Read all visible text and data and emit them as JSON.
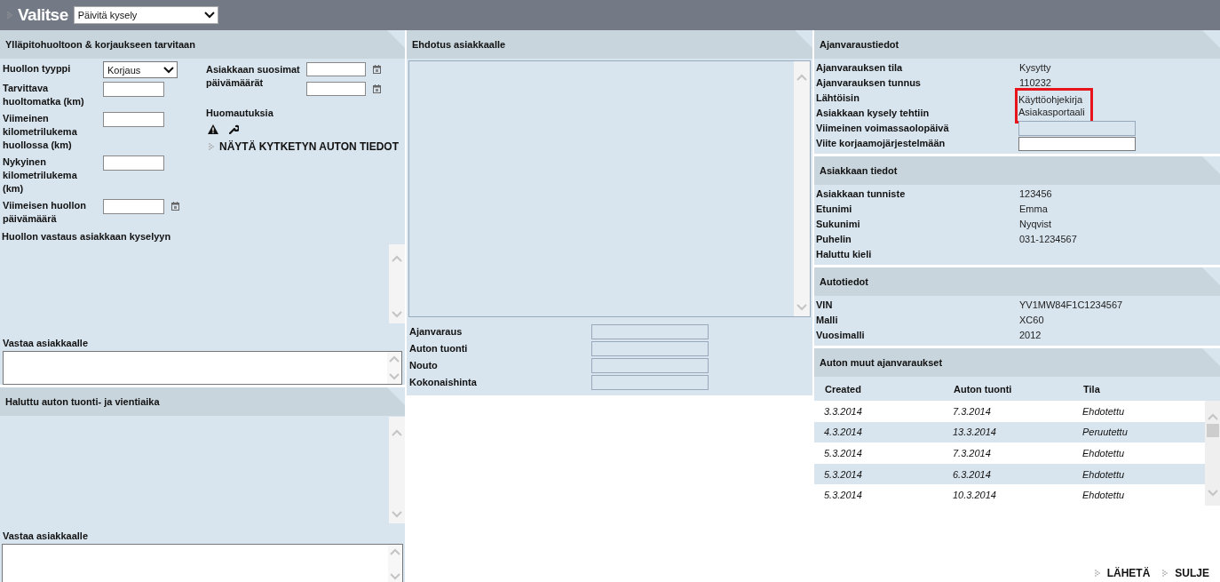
{
  "header": {
    "title": "Valitse",
    "action_select": "Päivitä kysely"
  },
  "service_panel": {
    "title": "Ylläpitohuoltoon & korjaukseen tarvitaan",
    "fields": [
      {
        "label": "Huollon tyyppi",
        "kind": "select",
        "value": "Korjaus"
      },
      {
        "label": "Tarvittava huoltomatka (km)",
        "kind": "input"
      },
      {
        "label": "Viimeinen kilometrilukema huollossa (km)",
        "kind": "input"
      },
      {
        "label": "Nykyinen kilometrilukema (km)",
        "kind": "input"
      },
      {
        "label": "Viimeisen huollon päivämäärä",
        "kind": "date"
      }
    ],
    "preferred_dates": {
      "label": "Asiakkaan suosimat päivämäärät",
      "inputs": [
        {
          "kind": "date"
        },
        {
          "kind": "date"
        }
      ]
    },
    "remarks_label": "Huomautuksia",
    "linked_car_link": "NÄYTÄ KYTKETYN AUTON TIEDOT",
    "response_label": "Huollon vastaus asiakkaan kyselyyn",
    "reply_label": "Vastaa asiakkaalle"
  },
  "delivery_panel": {
    "title": "Haluttu auton tuonti- ja vientiaika",
    "reply_label": "Vastaa asiakkaalle"
  },
  "proposal_panel": {
    "title": "Ehdotus asiakkaalle",
    "fields": [
      {
        "label": "Ajanvaraus"
      },
      {
        "label": "Auton tuonti"
      },
      {
        "label": "Nouto"
      },
      {
        "label": "Kokonaishinta"
      }
    ]
  },
  "info_panels": [
    {
      "title": "Ajanvaraustiedot",
      "rows": [
        {
          "label": "Ajanvarauksen tila",
          "kind": "text",
          "value": "Kysytty",
          "highlighted": false
        },
        {
          "label": "Ajanvarauksen tunnus",
          "kind": "text",
          "value": "110232",
          "highlighted": false
        },
        {
          "label": "Lähtöisin",
          "kind": "text",
          "value": "Käyttöohjekirja",
          "highlighted": true
        },
        {
          "label": "Asiakkaan kysely tehtiin",
          "kind": "text",
          "value": "Asiakasportaali",
          "highlighted": true
        },
        {
          "label": "Viimeinen voimassaolopäivä",
          "kind": "locked_input",
          "highlighted": false
        },
        {
          "label": "Viite korjaamojärjestelmään",
          "kind": "input",
          "highlighted": false
        }
      ]
    },
    {
      "title": "Asiakkaan tiedot",
      "rows": [
        {
          "label": "Asiakkaan tunniste",
          "kind": "text",
          "value": "123456",
          "highlighted": false
        },
        {
          "label": "Etunimi",
          "kind": "text",
          "value": "Emma",
          "highlighted": false
        },
        {
          "label": "Sukunimi",
          "kind": "text",
          "value": "Nyqvist",
          "highlighted": false
        },
        {
          "label": "Puhelin",
          "kind": "text",
          "value": "031-1234567",
          "highlighted": false
        },
        {
          "label": "Haluttu kieli",
          "kind": "text",
          "highlighted": false
        }
      ]
    },
    {
      "title": "Autotiedot",
      "rows": [
        {
          "label": "VIN",
          "kind": "text",
          "value": "YV1MW84F1C1234567",
          "highlighted": false
        },
        {
          "label": "Malli",
          "kind": "text",
          "value": "XC60",
          "highlighted": false
        },
        {
          "label": "Vuosimalli",
          "kind": "text",
          "value": "2012",
          "highlighted": false
        }
      ]
    }
  ],
  "bookings_panel": {
    "title": "Auton muut ajanvaraukset",
    "columns": [
      "Created",
      "Auton tuonti",
      "Tila"
    ],
    "rows": [
      [
        "3.3.2014",
        "7.3.2014",
        "Ehdotettu"
      ],
      [
        "4.3.2014",
        "13.3.2014",
        "Peruutettu"
      ],
      [
        "5.3.2014",
        "7.3.2014",
        "Ehdotettu"
      ],
      [
        "5.3.2014",
        "6.3.2014",
        "Ehdotettu"
      ],
      [
        "5.3.2014",
        "10.3.2014",
        "Ehdotettu"
      ]
    ]
  },
  "actions": [
    "LÄHETÄ",
    "SULJE"
  ]
}
